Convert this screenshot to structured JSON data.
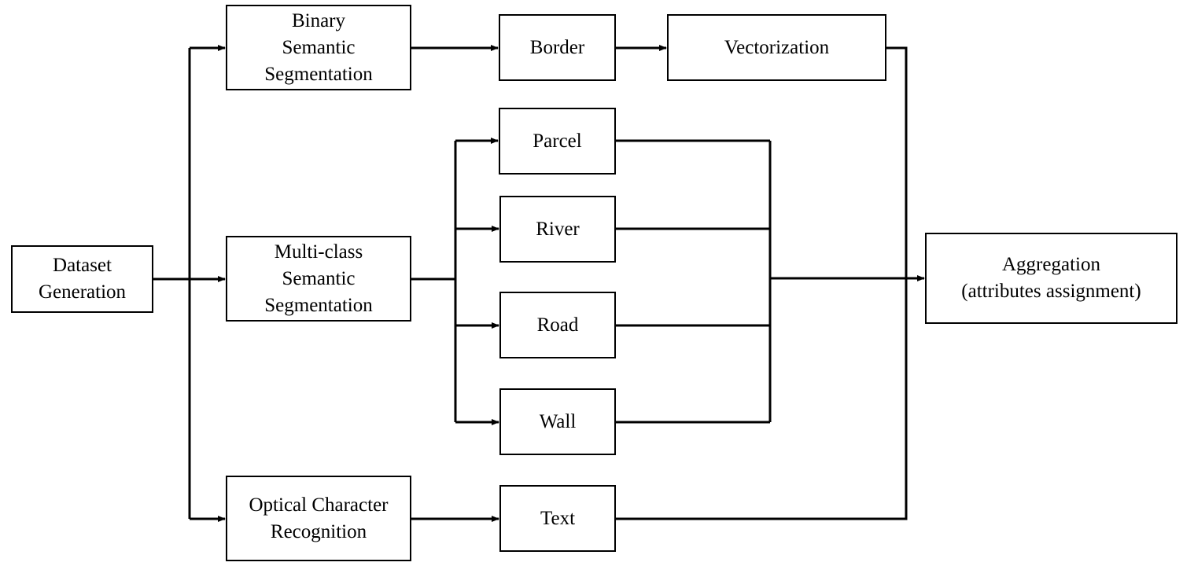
{
  "diagram": {
    "type": "flowchart",
    "nodes": {
      "dataset": "Dataset\nGeneration",
      "binary": "Binary\nSemantic\nSegmentation",
      "multi": "Multi-class\nSemantic\nSegmentation",
      "ocr": "Optical Character\nRecognition",
      "border": "Border",
      "vector": "Vectorization",
      "parcel": "Parcel",
      "river": "River",
      "road": "Road",
      "wall": "Wall",
      "text": "Text",
      "agg": "Aggregation\n(attributes assignment)"
    },
    "edges": [
      [
        "dataset",
        "binary"
      ],
      [
        "dataset",
        "multi"
      ],
      [
        "dataset",
        "ocr"
      ],
      [
        "binary",
        "border"
      ],
      [
        "border",
        "vector"
      ],
      [
        "vector",
        "agg"
      ],
      [
        "multi",
        "parcel"
      ],
      [
        "multi",
        "river"
      ],
      [
        "multi",
        "road"
      ],
      [
        "multi",
        "wall"
      ],
      [
        "parcel",
        "agg"
      ],
      [
        "river",
        "agg"
      ],
      [
        "road",
        "agg"
      ],
      [
        "wall",
        "agg"
      ],
      [
        "ocr",
        "text"
      ],
      [
        "text",
        "agg"
      ]
    ]
  }
}
